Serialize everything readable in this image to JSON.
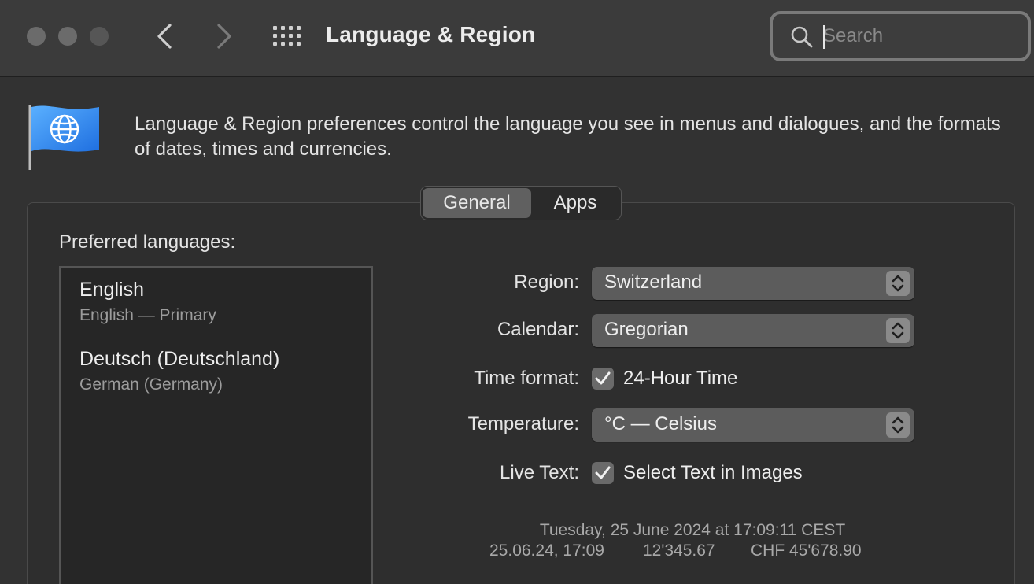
{
  "window": {
    "title": "Language & Region",
    "search_placeholder": "Search"
  },
  "intro": {
    "description": "Language & Region preferences control the language you see in menus and dialogues, and the formats of dates, times and currencies."
  },
  "tabs": [
    {
      "label": "General",
      "selected": true
    },
    {
      "label": "Apps",
      "selected": false
    }
  ],
  "languages": {
    "heading": "Preferred languages:",
    "items": [
      {
        "name": "English",
        "subtitle": "English — Primary"
      },
      {
        "name": "Deutsch (Deutschland)",
        "subtitle": "German (Germany)"
      }
    ]
  },
  "settings": {
    "region": {
      "label": "Region:",
      "value": "Switzerland"
    },
    "calendar": {
      "label": "Calendar:",
      "value": "Gregorian"
    },
    "time_format": {
      "label": "Time format:",
      "option": "24-Hour Time",
      "checked": true
    },
    "temperature": {
      "label": "Temperature:",
      "value": "°C — Celsius"
    },
    "live_text": {
      "label": "Live Text:",
      "option": "Select Text in Images",
      "checked": true
    }
  },
  "preview": {
    "long_date": "Tuesday, 25 June 2024 at 17:09:11 CEST",
    "short_date": "25.06.24, 17:09",
    "number": "12'345.67",
    "currency": "CHF 45'678.90"
  }
}
